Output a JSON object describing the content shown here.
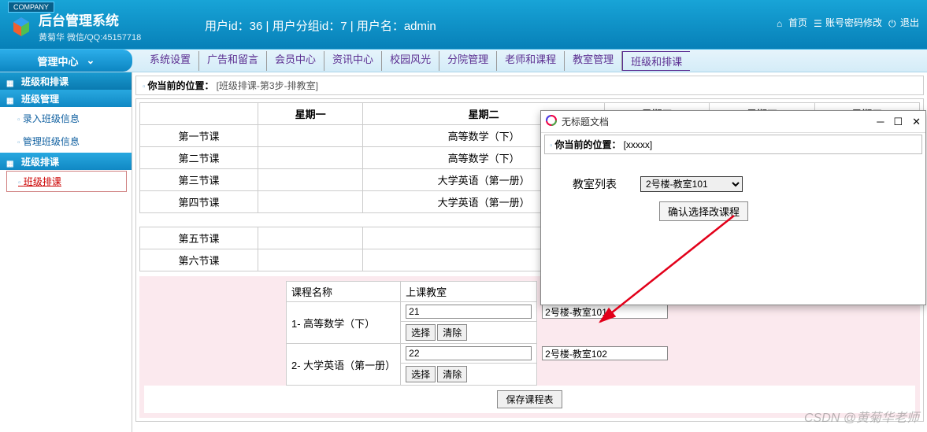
{
  "header": {
    "company_badge": "COMPANY",
    "title": "后台管理系统",
    "subtitle": "黄菊华 微信/QQ:45157718",
    "center_text": "用户id：36 | 用户分组id：7 | 用户名：admin",
    "home_link": "首页",
    "pwd_link": "账号密码修改",
    "logout_link": "退出"
  },
  "nav": {
    "left_tab": "管理中心",
    "arrow": "⌄",
    "items": [
      "系统设置",
      "广告和留言",
      "会员中心",
      "资讯中心",
      "校园风光",
      "分院管理",
      "老师和课程",
      "教室管理",
      "班级和排课"
    ]
  },
  "sidebar": {
    "top": "班级和排课",
    "section1": "班级管理",
    "section1_items": [
      "录入班级信息",
      "管理班级信息"
    ],
    "section2": "班级排课",
    "section2_items": [
      "班级排课"
    ]
  },
  "breadcrumb": {
    "label": "你当前的位置：",
    "value": "[班级排课-第3步-排教室]"
  },
  "schedule": {
    "headers": [
      "",
      "星期一",
      "星期二",
      "星期三",
      "星期四",
      "星期五"
    ],
    "rows": [
      {
        "label": "第一节课",
        "cells": [
          "",
          "高等数学（下）"
        ]
      },
      {
        "label": "第二节课",
        "cells": [
          "",
          "高等数学（下）"
        ]
      },
      {
        "label": "第三节课",
        "cells": [
          "",
          "大学英语（第一册）"
        ]
      },
      {
        "label": "第四节课",
        "cells": [
          "",
          "大学英语（第一册）"
        ]
      }
    ],
    "rows2": [
      {
        "label": "第五节课",
        "cells": [
          "",
          ""
        ]
      },
      {
        "label": "第六节课",
        "cells": [
          "",
          ""
        ]
      }
    ]
  },
  "assign": {
    "col1": "课程名称",
    "col2": "上课教室",
    "rows": [
      {
        "name": "1- 高等数学（下）",
        "id": "21",
        "room": "2号楼-教室101"
      },
      {
        "name": "2- 大学英语（第一册）",
        "id": "22",
        "room": "2号楼-教室102"
      }
    ],
    "select_btn": "选择",
    "clear_btn": "清除",
    "save_btn": "保存课程表"
  },
  "popup": {
    "title": "无标题文档",
    "bc_label": "你当前的位置：",
    "bc_value": "[xxxxx]",
    "room_label": "教室列表",
    "room_value": "2号楼-教室101",
    "confirm_btn": "确认选择改课程"
  },
  "watermark": "CSDN @黄菊华老师"
}
